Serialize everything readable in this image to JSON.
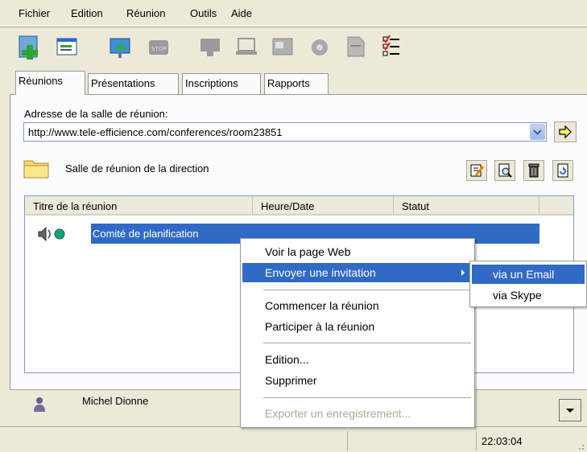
{
  "menubar": {
    "items": [
      "Fichier",
      "Edition",
      "Réunion",
      "Outils",
      "Aide"
    ]
  },
  "toolbar": {
    "icons": [
      "add-meeting-icon",
      "meeting-properties-icon",
      "presentation-icon",
      "stop-icon",
      "monitor-icon",
      "laptop-icon",
      "window-icon",
      "camera-icon",
      "document-icon",
      "checklist-icon"
    ]
  },
  "tabs": [
    "Réunions",
    "Présentations",
    "Inscriptions",
    "Rapports"
  ],
  "address": {
    "label": "Adresse de la salle de réunion:",
    "value": "http://www.tele-efficience.com/conferences/room23851"
  },
  "room": {
    "name": "Salle de réunion de la direction"
  },
  "list": {
    "columns": [
      "Titre de la réunion",
      "Heure/Date",
      "Statut"
    ],
    "rows": [
      {
        "title": "Comité de planification",
        "date": "",
        "status": ""
      }
    ]
  },
  "context_menu": {
    "items": [
      "Voir la page Web",
      "Envoyer une invitation",
      "Commencer la réunion",
      "Participer à la réunion",
      "Edition...",
      "Supprimer",
      "Exporter un enregistrement..."
    ]
  },
  "submenu": {
    "items": [
      "via un Email",
      "via Skype"
    ]
  },
  "user": {
    "name": "Michel Dionne"
  },
  "status": {
    "clock": "22:03:04"
  },
  "colors": {
    "selection": "#316ac5",
    "window_bg": "#ece9d8",
    "panel_bg": "#fcfcfe"
  }
}
